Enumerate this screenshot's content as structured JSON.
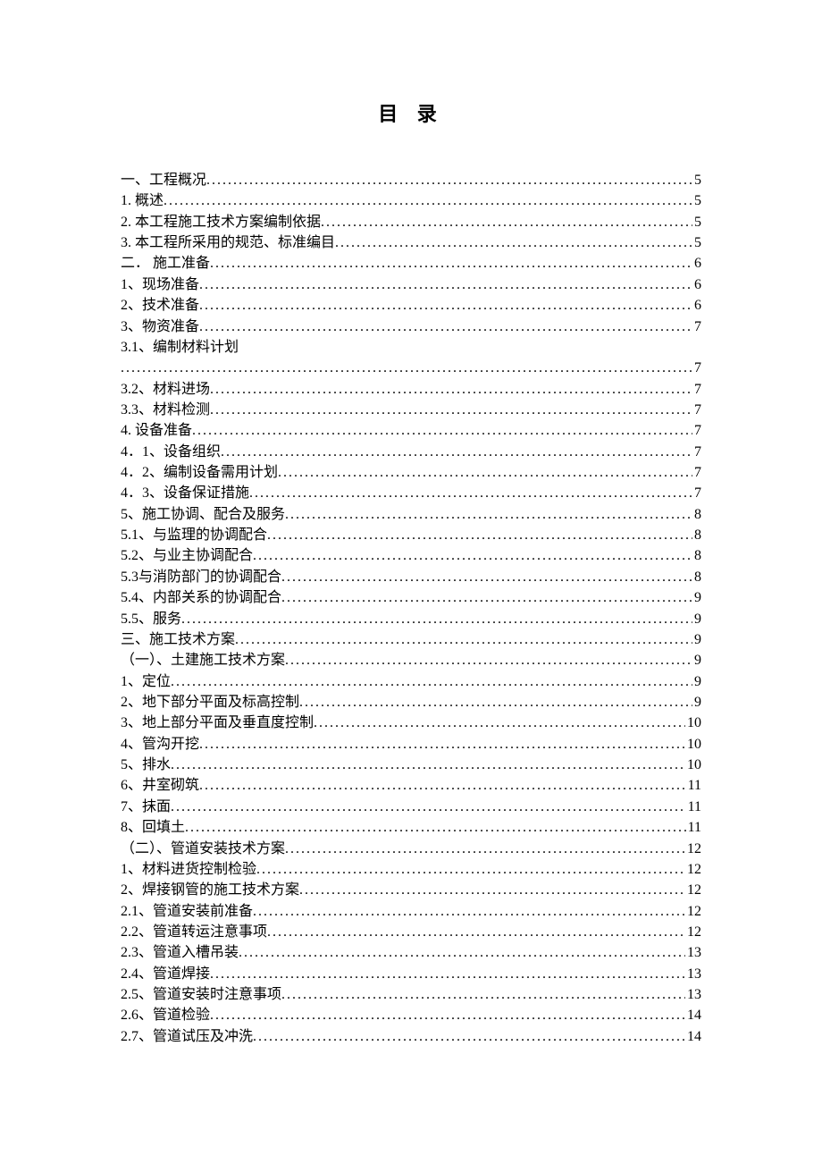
{
  "title": "目 录",
  "entries": [
    {
      "label": "一、工程概况",
      "page": "5"
    },
    {
      "label": "1. 概述",
      "page": "5"
    },
    {
      "label": "2.  本工程施工技术方案编制依据",
      "page": "5"
    },
    {
      "label": "3. 本工程所采用的规范、标准编目",
      "page": "5"
    },
    {
      "label": "二． 施工准备",
      "page": "6"
    },
    {
      "label": "1、现场准备",
      "page": "6"
    },
    {
      "label": "2、技术准备",
      "page": "6"
    },
    {
      "label": "3、物资准备",
      "page": "7"
    },
    {
      "label": "3.1、编制材料计划",
      "page": "",
      "noPage": true
    },
    {
      "label": "",
      "page": "7"
    },
    {
      "label": "3.2、材料进场",
      "page": "7"
    },
    {
      "label": "3.3、材料检测",
      "page": "7"
    },
    {
      "label": "4. 设备准备",
      "page": "7"
    },
    {
      "label": "4．1、设备组织",
      "page": "7"
    },
    {
      "label": "4．2、编制设备需用计划",
      "page": "7"
    },
    {
      "label": "4．3、设备保证措施",
      "page": "7"
    },
    {
      "label": "5、施工协调、配合及服务",
      "page": "8"
    },
    {
      "label": "5.1、与监理的协调配合",
      "page": "8"
    },
    {
      "label": "5.2、与业主协调配合",
      "page": "8"
    },
    {
      "label": "5.3与消防部门的协调配合",
      "page": "8"
    },
    {
      "label": "5.4、内部关系的协调配合",
      "page": "9"
    },
    {
      "label": "5.5、服务",
      "page": "9"
    },
    {
      "label": "三、施工技术方案",
      "page": "9"
    },
    {
      "label": "（一）、土建施工技术方案",
      "page": "9"
    },
    {
      "label": "1、定位",
      "page": "9"
    },
    {
      "label": "2、地下部分平面及标高控制",
      "page": "9"
    },
    {
      "label": "3、地上部分平面及垂直度控制",
      "page": "10"
    },
    {
      "label": "4、管沟开挖",
      "page": "10"
    },
    {
      "label": "5、排水",
      "page": "10"
    },
    {
      "label": "6、井室砌筑",
      "page": "11"
    },
    {
      "label": "7、抹面",
      "page": "11"
    },
    {
      "label": "8、回填土",
      "page": "11"
    },
    {
      "label": "（二）、管道安装技术方案",
      "page": "12"
    },
    {
      "label": "1、材料进货控制检验",
      "page": "12"
    },
    {
      "label": "2、焊接钢管的施工技术方案",
      "page": "12"
    },
    {
      "label": "2.1、管道安装前准备",
      "page": "12"
    },
    {
      "label": "2.2、管道转运注意事项",
      "page": "12"
    },
    {
      "label": "2.3、管道入槽吊装",
      "page": "13"
    },
    {
      "label": "2.4、管道焊接",
      "page": "13"
    },
    {
      "label": "2.5、管道安装时注意事项",
      "page": "13"
    },
    {
      "label": "2.6、管道检验",
      "page": "14"
    },
    {
      "label": "2.7、管道试压及冲洗",
      "page": "14"
    }
  ]
}
